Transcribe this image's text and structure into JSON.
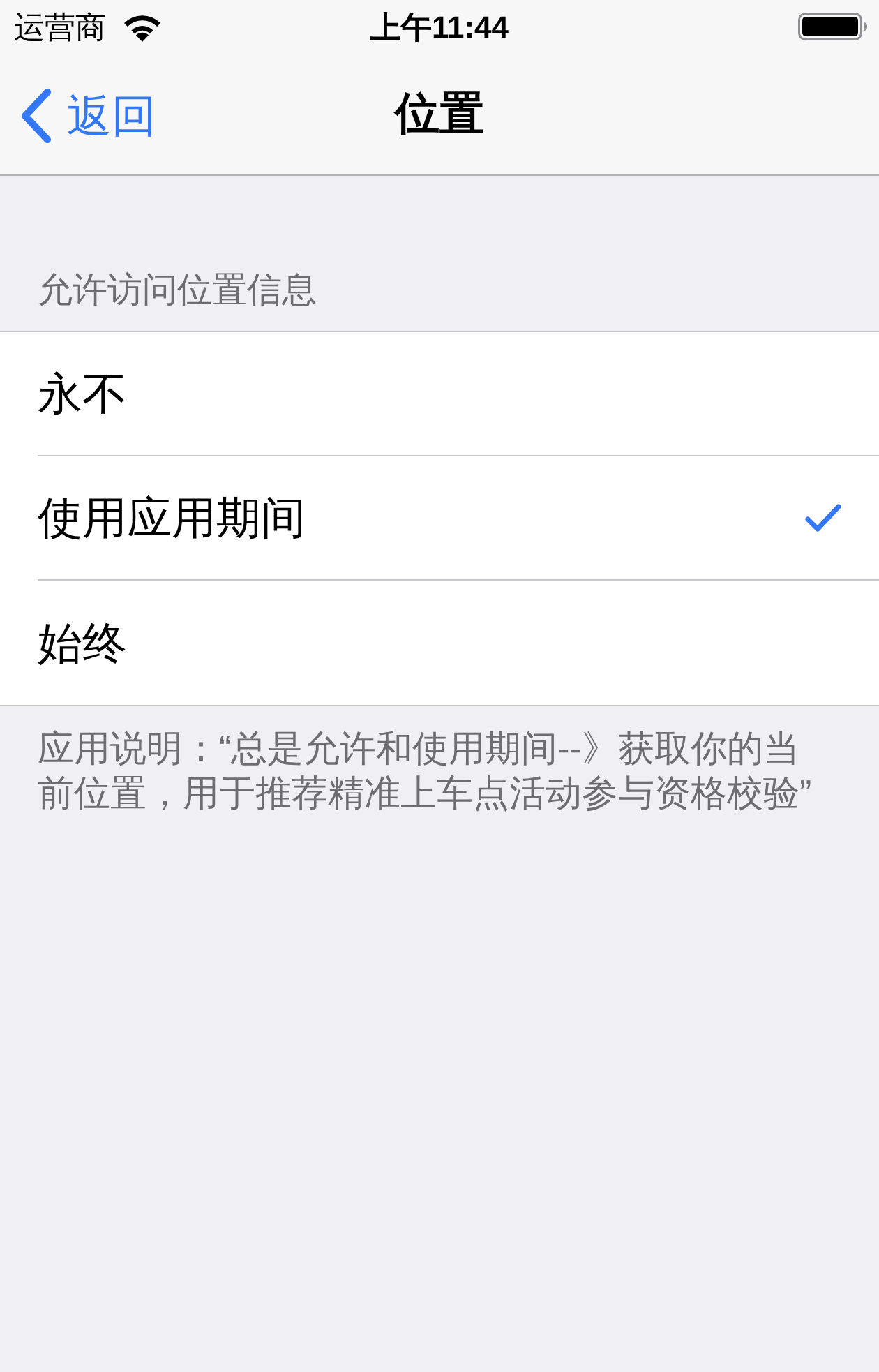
{
  "status_bar": {
    "carrier": "运营商",
    "time": "上午11:44"
  },
  "nav_bar": {
    "back": "返回",
    "title": "位置"
  },
  "section": {
    "header": "允许访问位置信息",
    "options": [
      {
        "label": "永不",
        "selected": false
      },
      {
        "label": "使用应用期间",
        "selected": true
      },
      {
        "label": "始终",
        "selected": false
      }
    ],
    "footer": "应用说明：“总是允许和使用期间--》获取你的当前位置，用于推荐精准上车点活动参与资格校验”"
  }
}
